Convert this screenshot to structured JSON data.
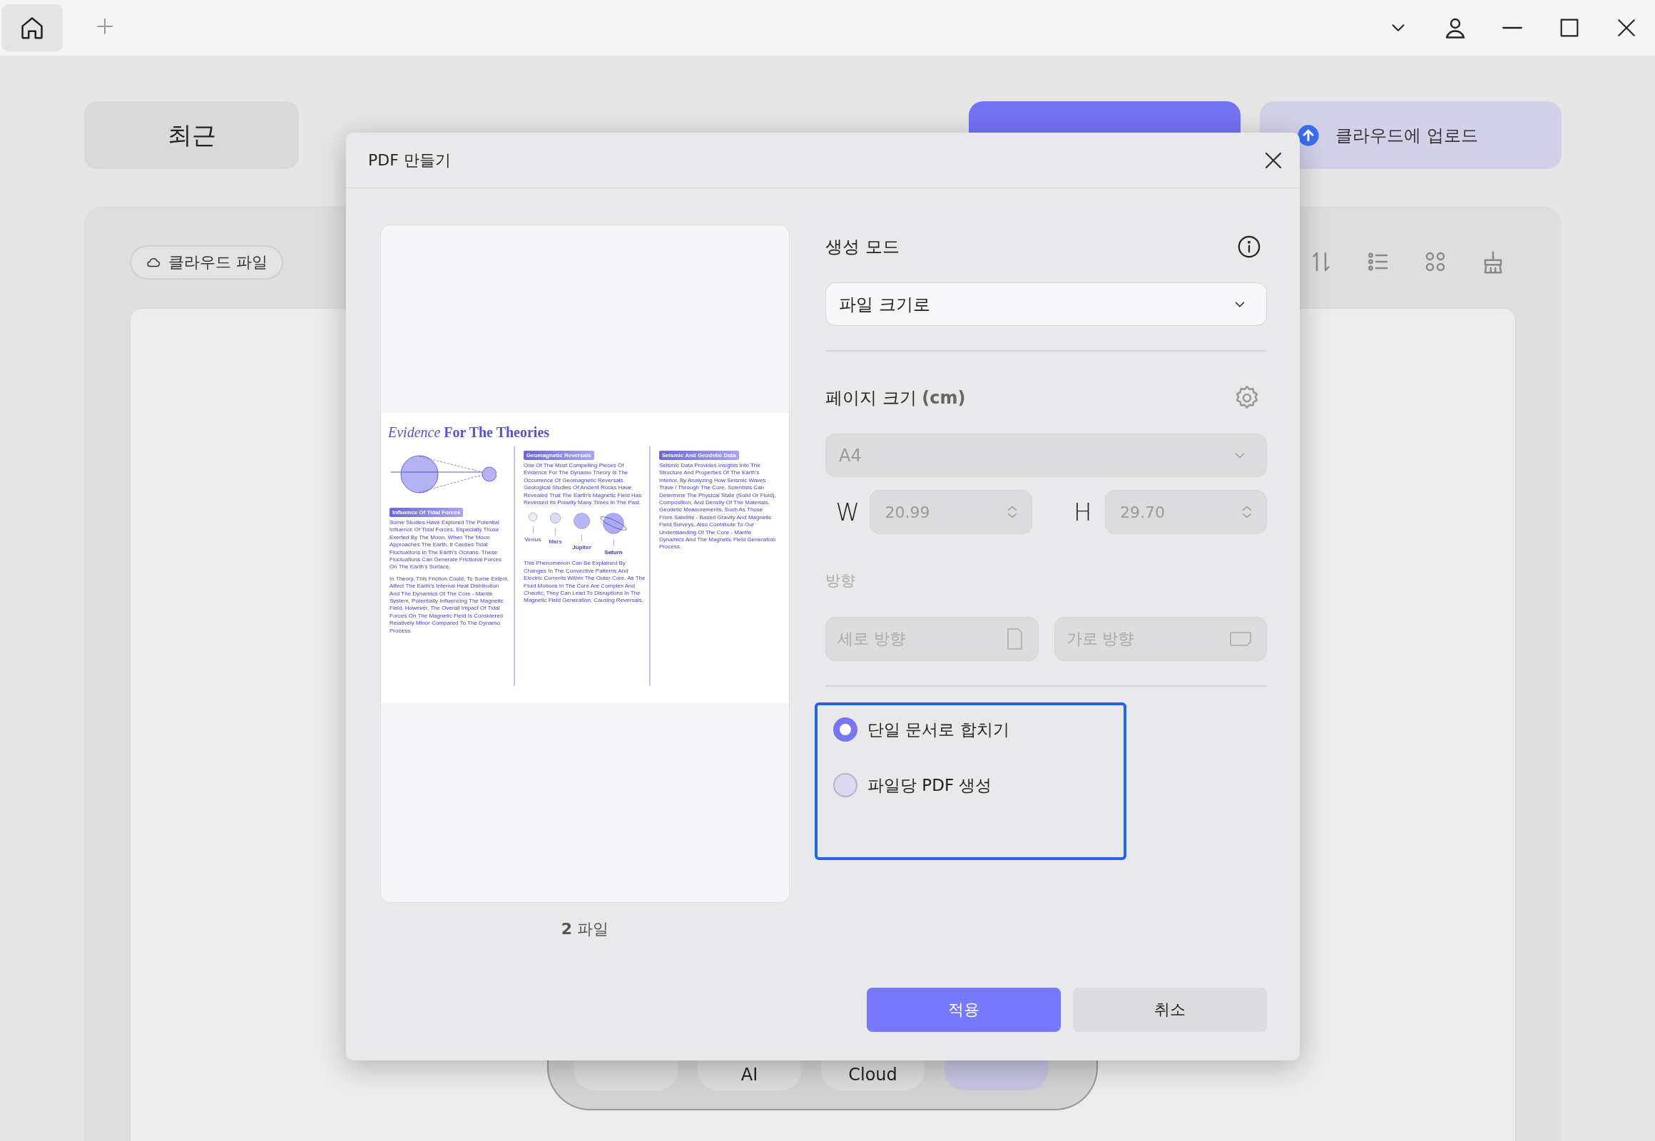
{
  "titlebar": {
    "home_tab_selected": true
  },
  "background": {
    "recent_tab": "최근",
    "upload_button": "클라우드에 업로드",
    "cloud_files_chip": "클라우드 파일",
    "dock": [
      {
        "kind": "blank"
      },
      {
        "kind": "text",
        "label": "AI"
      },
      {
        "kind": "text",
        "label": "Cloud"
      },
      {
        "kind": "accent"
      }
    ]
  },
  "dialog": {
    "title": "PDF 만들기",
    "preview": {
      "document": {
        "title": "*Evidence* **For The Theories**",
        "columns": [
          {
            "blocks": [
              {
                "kind": "diagram"
              },
              {
                "kind": "heading",
                "text": "Influence Of Tidal Forces"
              },
              {
                "kind": "paragraph",
                "text": "Some Studies Have Explored The Potential Influence Of Tidal Forces, Especially Those Exerted By The Moon. When The Moon Approaches The Earth, It Causes Tidal Fluctuations In The Earth's Oceans. These Fluctuations Can Generate Frictional Forces On The Earth's Surface."
              },
              {
                "kind": "paragraph",
                "text": "In Theory, This Friction Could, To Some Extent, Affect The Earth's Internal Heat Distribution And The Dynamics Of The Core - Mantle System, Potentially Influencing The Magnetic Field. However, The Overall Impact Of Tidal Forces On The Magnetic Field Is Considered Relatively Minor Compared To The Dynamo Process."
              }
            ]
          },
          {
            "blocks": [
              {
                "kind": "heading",
                "text": "Geomagnetic Reversals"
              },
              {
                "kind": "paragraph",
                "text": "One Of The Most Compelling Pieces Of Evidence For The Dynamo Theory Is The Occurrence Of Geomagnetic Reversals. Geological Studies Of Ancient Rocks Have Revealed That The Earth's Magnetic Field Has Reversed Its Polarity Many Times In The Past."
              },
              {
                "kind": "planets",
                "items": [
                  {
                    "name": "Venus"
                  },
                  {
                    "name": "Mars"
                  },
                  {
                    "name": "Jupiter"
                  },
                  {
                    "name": "Saturn"
                  }
                ]
              },
              {
                "kind": "paragraph",
                "text": "This Phenomenon Can Be Explained By Changes In The Convective Patterns And Electric Currents Within The Outer Core. As The Fluid Motions In The Core Are Complex And Chaotic, They Can Lead To Disruptions In The Magnetic Field Generation, Causing Reversals."
              }
            ]
          },
          {
            "blocks": [
              {
                "kind": "heading",
                "text": "Seismic And Geodetic Data"
              },
              {
                "kind": "paragraph",
                "text": "Seismic Data Provides Insights Into The Structure And Properties Of The Earth's Interior. By Analyzing How Seismic Waves Trave l Through The Core, Scientists Can Determine The Physical State (Solid Or Fluid), Composition, And Density Of The Materials. Geodetic Measurements, Such As Those From Satellite - Based Gravity And Magnetic Field Surveys, Also Contribute To Our Understanding Of The Core - Mantle Dynamics And The Magnetic Field Generation Process."
              }
            ]
          }
        ]
      },
      "file_count": "**2** 파일"
    },
    "mode": {
      "label": "생성 모드",
      "value": "파일 크기로"
    },
    "page_size": {
      "label": "페이지 크기 **(cm)**",
      "preset": "A4",
      "disabled": true,
      "width": {
        "label": "W",
        "value": "20.99"
      },
      "height": {
        "label": "H",
        "value": "29.70"
      }
    },
    "orientation": {
      "label": "방향",
      "disabled": true,
      "options": [
        {
          "kind": "portrait",
          "label": "세로 방향"
        },
        {
          "kind": "landscape",
          "label": "가로 방향"
        }
      ]
    },
    "output": {
      "focused": true,
      "options": [
        {
          "label": "단일 문서로 합치기",
          "selected": true
        },
        {
          "label": "파일당 PDF 생성",
          "selected": false
        }
      ]
    },
    "buttons": [
      {
        "kind": "primary",
        "label": "적용"
      },
      {
        "kind": "secondary",
        "label": "취소"
      }
    ]
  }
}
